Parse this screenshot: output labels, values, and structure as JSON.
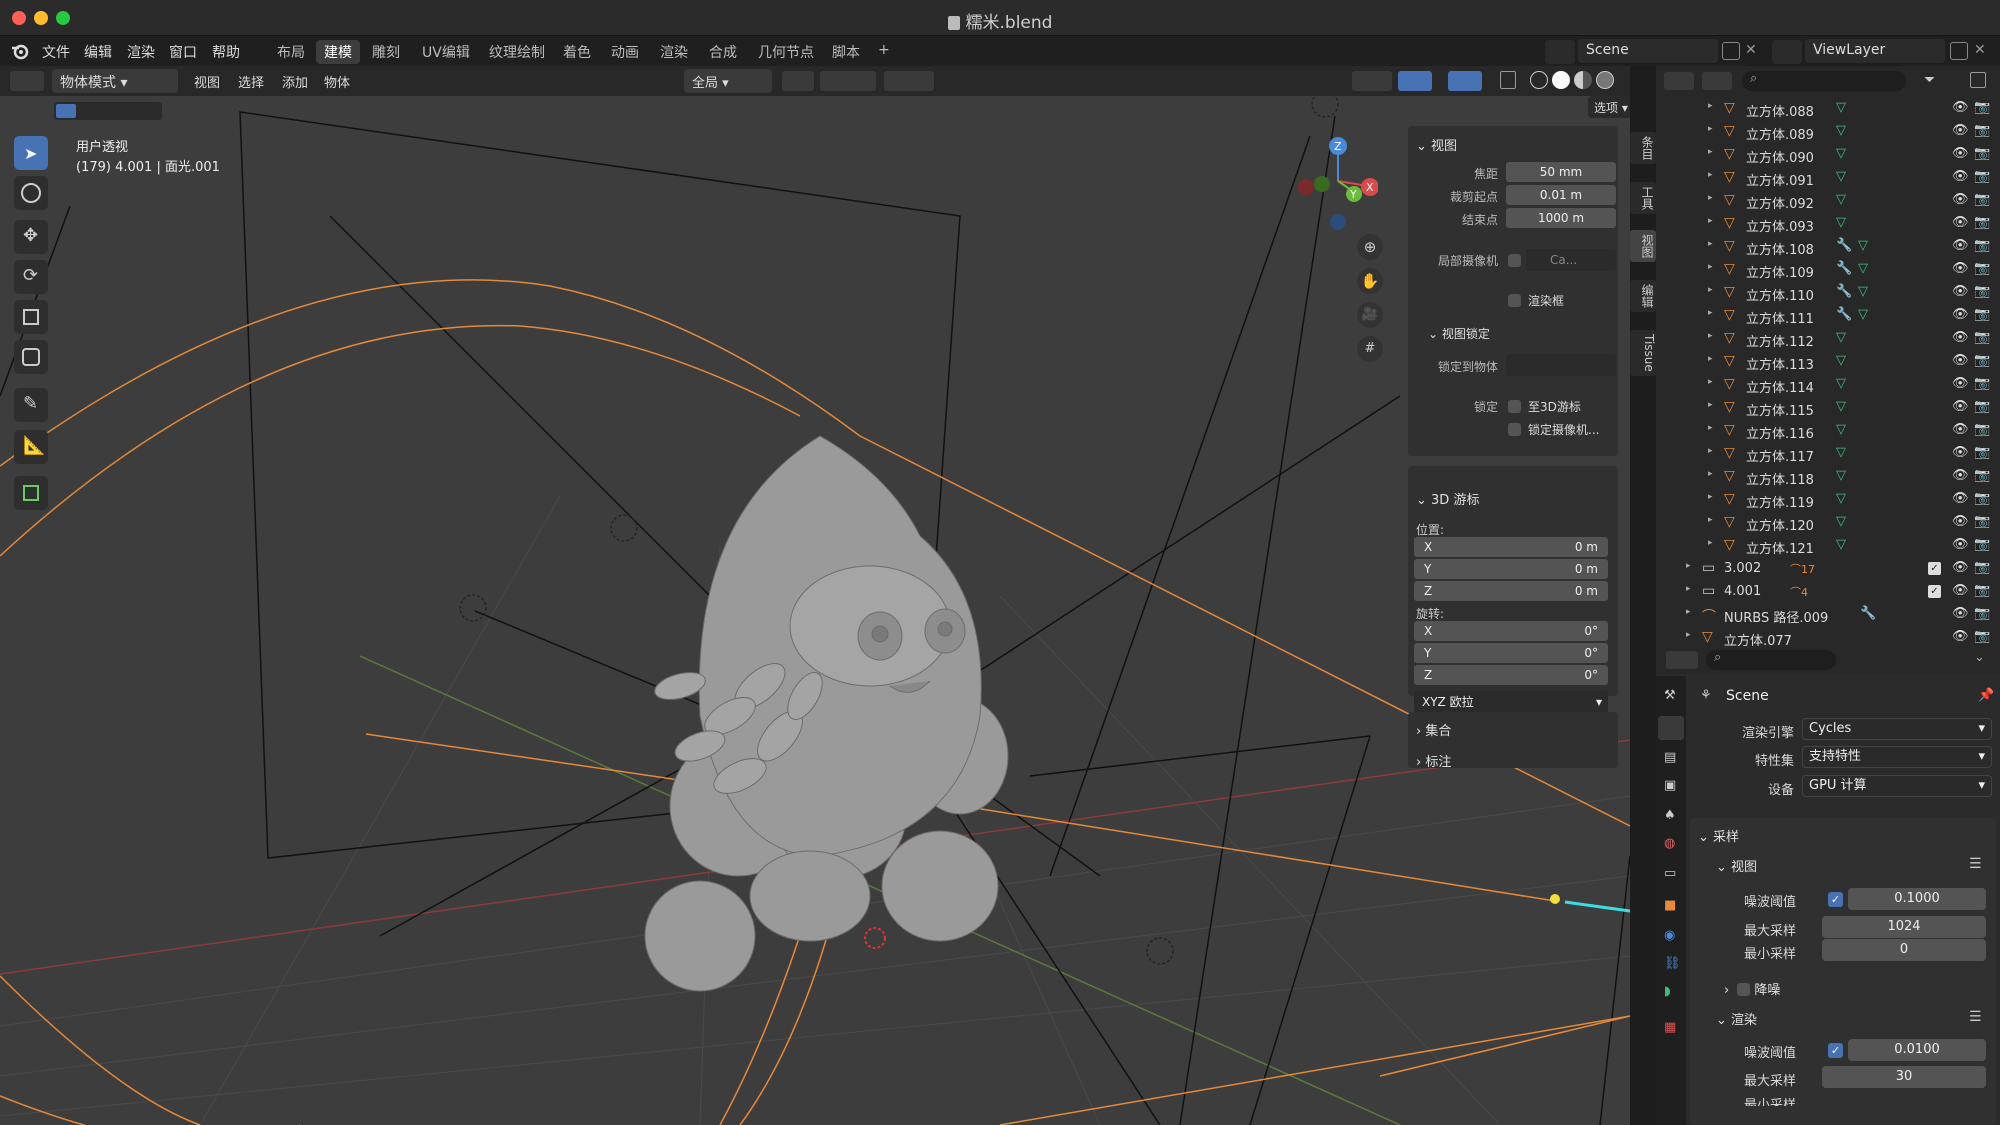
{
  "window": {
    "title": "糯米.blend"
  },
  "menu": {
    "items": [
      "文件",
      "编辑",
      "渲染",
      "窗口",
      "帮助"
    ],
    "workspaces": [
      "布局",
      "建模",
      "雕刻",
      "UV编辑",
      "纹理绘制",
      "着色",
      "动画",
      "渲染",
      "合成",
      "几何节点",
      "脚本"
    ],
    "add_tab": "+",
    "scene": "Scene",
    "view_layer": "ViewLayer"
  },
  "viewport_header": {
    "mode": "物体模式",
    "menus": [
      "视图",
      "选择",
      "添加",
      "物体"
    ],
    "orientation": "全局",
    "options": "选项"
  },
  "viewport": {
    "view_name": "用户透视",
    "object_info": "(179) 4.001 | 面光.001",
    "gizmo": {
      "x": "X",
      "y": "Y",
      "z": "Z"
    }
  },
  "npanel": {
    "view": {
      "title": "视图",
      "focal_label": "焦距",
      "focal": "50 mm",
      "clip_start_label": "裁剪起点",
      "clip_start": "0.01 m",
      "clip_end_label": "结束点",
      "clip_end": "1000 m",
      "local_camera_label": "局部摄像机",
      "local_camera": "Ca...",
      "render_region": "渲染框"
    },
    "view_lock": {
      "title": "视图锁定",
      "lock_object_label": "锁定到物体",
      "lock_label": "锁定",
      "to_3d_cursor": "至3D游标",
      "lock_camera": "锁定摄像机..."
    },
    "cursor": {
      "title": "3D 游标",
      "location_label": "位置:",
      "x_label": "X",
      "x": "0 m",
      "y_label": "Y",
      "y": "0 m",
      "z_label": "Z",
      "z": "0 m",
      "rotation_label": "旋转:",
      "rx_label": "X",
      "rx": "0°",
      "ry_label": "Y",
      "ry": "0°",
      "rz_label": "Z",
      "rz": "0°",
      "rotation_mode": "XYZ 欧拉"
    },
    "collection": {
      "title": "集合"
    },
    "annotations": {
      "title": "标注"
    },
    "tabs": [
      "条目",
      "工具",
      "视图",
      "编辑",
      "Tissue"
    ]
  },
  "outliner": {
    "rows": [
      {
        "name": "立方体.088",
        "mod": false
      },
      {
        "name": "立方体.089",
        "mod": false
      },
      {
        "name": "立方体.090",
        "mod": false
      },
      {
        "name": "立方体.091",
        "mod": false
      },
      {
        "name": "立方体.092",
        "mod": false
      },
      {
        "name": "立方体.093",
        "mod": false
      },
      {
        "name": "立方体.108",
        "mod": true
      },
      {
        "name": "立方体.109",
        "mod": true
      },
      {
        "name": "立方体.110",
        "mod": true
      },
      {
        "name": "立方体.111",
        "mod": true
      },
      {
        "name": "立方体.112",
        "mod": false
      },
      {
        "name": "立方体.113",
        "mod": false
      },
      {
        "name": "立方体.114",
        "mod": false
      },
      {
        "name": "立方体.115",
        "mod": false
      },
      {
        "name": "立方体.116",
        "mod": false
      },
      {
        "name": "立方体.117",
        "mod": false
      },
      {
        "name": "立方体.118",
        "mod": false
      },
      {
        "name": "立方体.119",
        "mod": false
      },
      {
        "name": "立方体.120",
        "mod": false
      },
      {
        "name": "立方体.121",
        "mod": false
      }
    ],
    "collections": [
      {
        "name": "3.002",
        "count": "17"
      },
      {
        "name": "4.001",
        "count": "4"
      }
    ],
    "nurbs": "NURBS 路径.009",
    "last": "立方体.077"
  },
  "properties": {
    "scene": "Scene",
    "engine_label": "渲染引擎",
    "engine": "Cycles",
    "feature_label": "特性集",
    "feature": "支持特性",
    "device_label": "设备",
    "device": "GPU 计算",
    "sampling": "采样",
    "viewport_section": "视图",
    "vp_noise_label": "噪波阈值",
    "vp_noise": "0.1000",
    "vp_max_label": "最大采样",
    "vp_max": "1024",
    "vp_min_label": "最小采样",
    "vp_min": "0",
    "denoise": "降噪",
    "render_section": "渲染",
    "r_noise_label": "噪波阈值",
    "r_noise": "0.0100",
    "r_max_label": "最大采样",
    "r_max": "30",
    "r_min_label": "最小采样"
  },
  "colors": {
    "accent": "#4772b3",
    "orange": "#e5893a",
    "mesh_green": "#3fbf7f",
    "object_orange": "#e5893a"
  }
}
